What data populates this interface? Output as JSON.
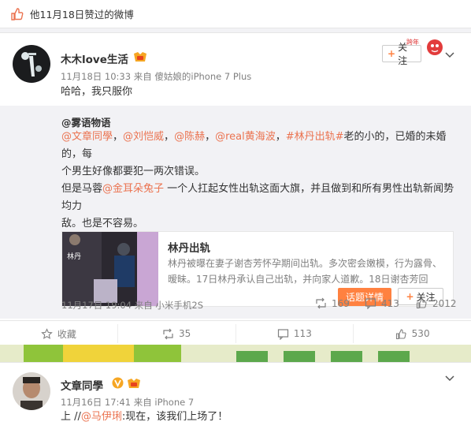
{
  "header": {
    "text": "他11月18日赞过的微博"
  },
  "post1": {
    "username": "木木love生活",
    "time": "11月18日 10:33",
    "from_prefix": "来自",
    "device": "傻姑娘的iPhone 7 Plus",
    "text": "哈哈，我只服你",
    "follow_label": "关注",
    "repost": {
      "author": "@雾语物语",
      "line1": [
        {
          "t": "@文章同學",
          "link": true
        },
        {
          "t": "，",
          "link": false
        },
        {
          "t": "@刘恺威",
          "link": true
        },
        {
          "t": "，",
          "link": false
        },
        {
          "t": "@陈赫",
          "link": true
        },
        {
          "t": "，",
          "link": false
        },
        {
          "t": "@real黄海波",
          "link": true
        },
        {
          "t": "，",
          "link": false
        },
        {
          "t": "#林丹出轨#",
          "link": true
        },
        {
          "t": "老的小的，已婚的未婚的，每",
          "link": false
        }
      ],
      "line2": "个男生好像都要犯一两次错误。",
      "line3": [
        {
          "t": "但是马蓉",
          "link": false
        },
        {
          "t": "@金耳朵兔子",
          "link": true
        },
        {
          "t": " 一个人扛起女性出轨这面大旗，并且做到和所有男性出轨新闻势均力",
          "link": false
        }
      ],
      "line4": "敌。也是不容易。",
      "card": {
        "title": "林丹出轨",
        "desc": "林丹被曝在妻子谢杏芳怀孕期间出轨。多次密会嫩模，行为露骨、暧昧。17日林丹承认自己出轨，并向家人道歉。18日谢杏芳回",
        "topic_btn": "话题详情",
        "follow_label": "关注"
      },
      "time": "11月17日 19:04",
      "from_prefix": "来自",
      "device": "小米手机2S",
      "stats": {
        "reposts": "169",
        "comments": "413",
        "likes": "2012"
      }
    },
    "actions": {
      "collect": "收藏",
      "repost": "35",
      "comment": "113",
      "like": "530"
    }
  },
  "post2": {
    "username": "文章同學",
    "time": "11月16日 17:41",
    "from_prefix": "来自",
    "device": "iPhone 7",
    "text_prefix": "上 //",
    "mention": "@马伊琍",
    "text_suffix": ":现在，该我们上场了！"
  },
  "icons": [
    "thumbs-up-icon",
    "vip-badge-icon",
    "verified-v-icon",
    "chevron-down-icon",
    "repost-icon",
    "comment-icon",
    "like-icon",
    "collect-icon"
  ],
  "colors": {
    "accent": "#eb7350",
    "orange": "#ff8140",
    "gray_text": "#808080",
    "bg": "#f2f2f5"
  }
}
